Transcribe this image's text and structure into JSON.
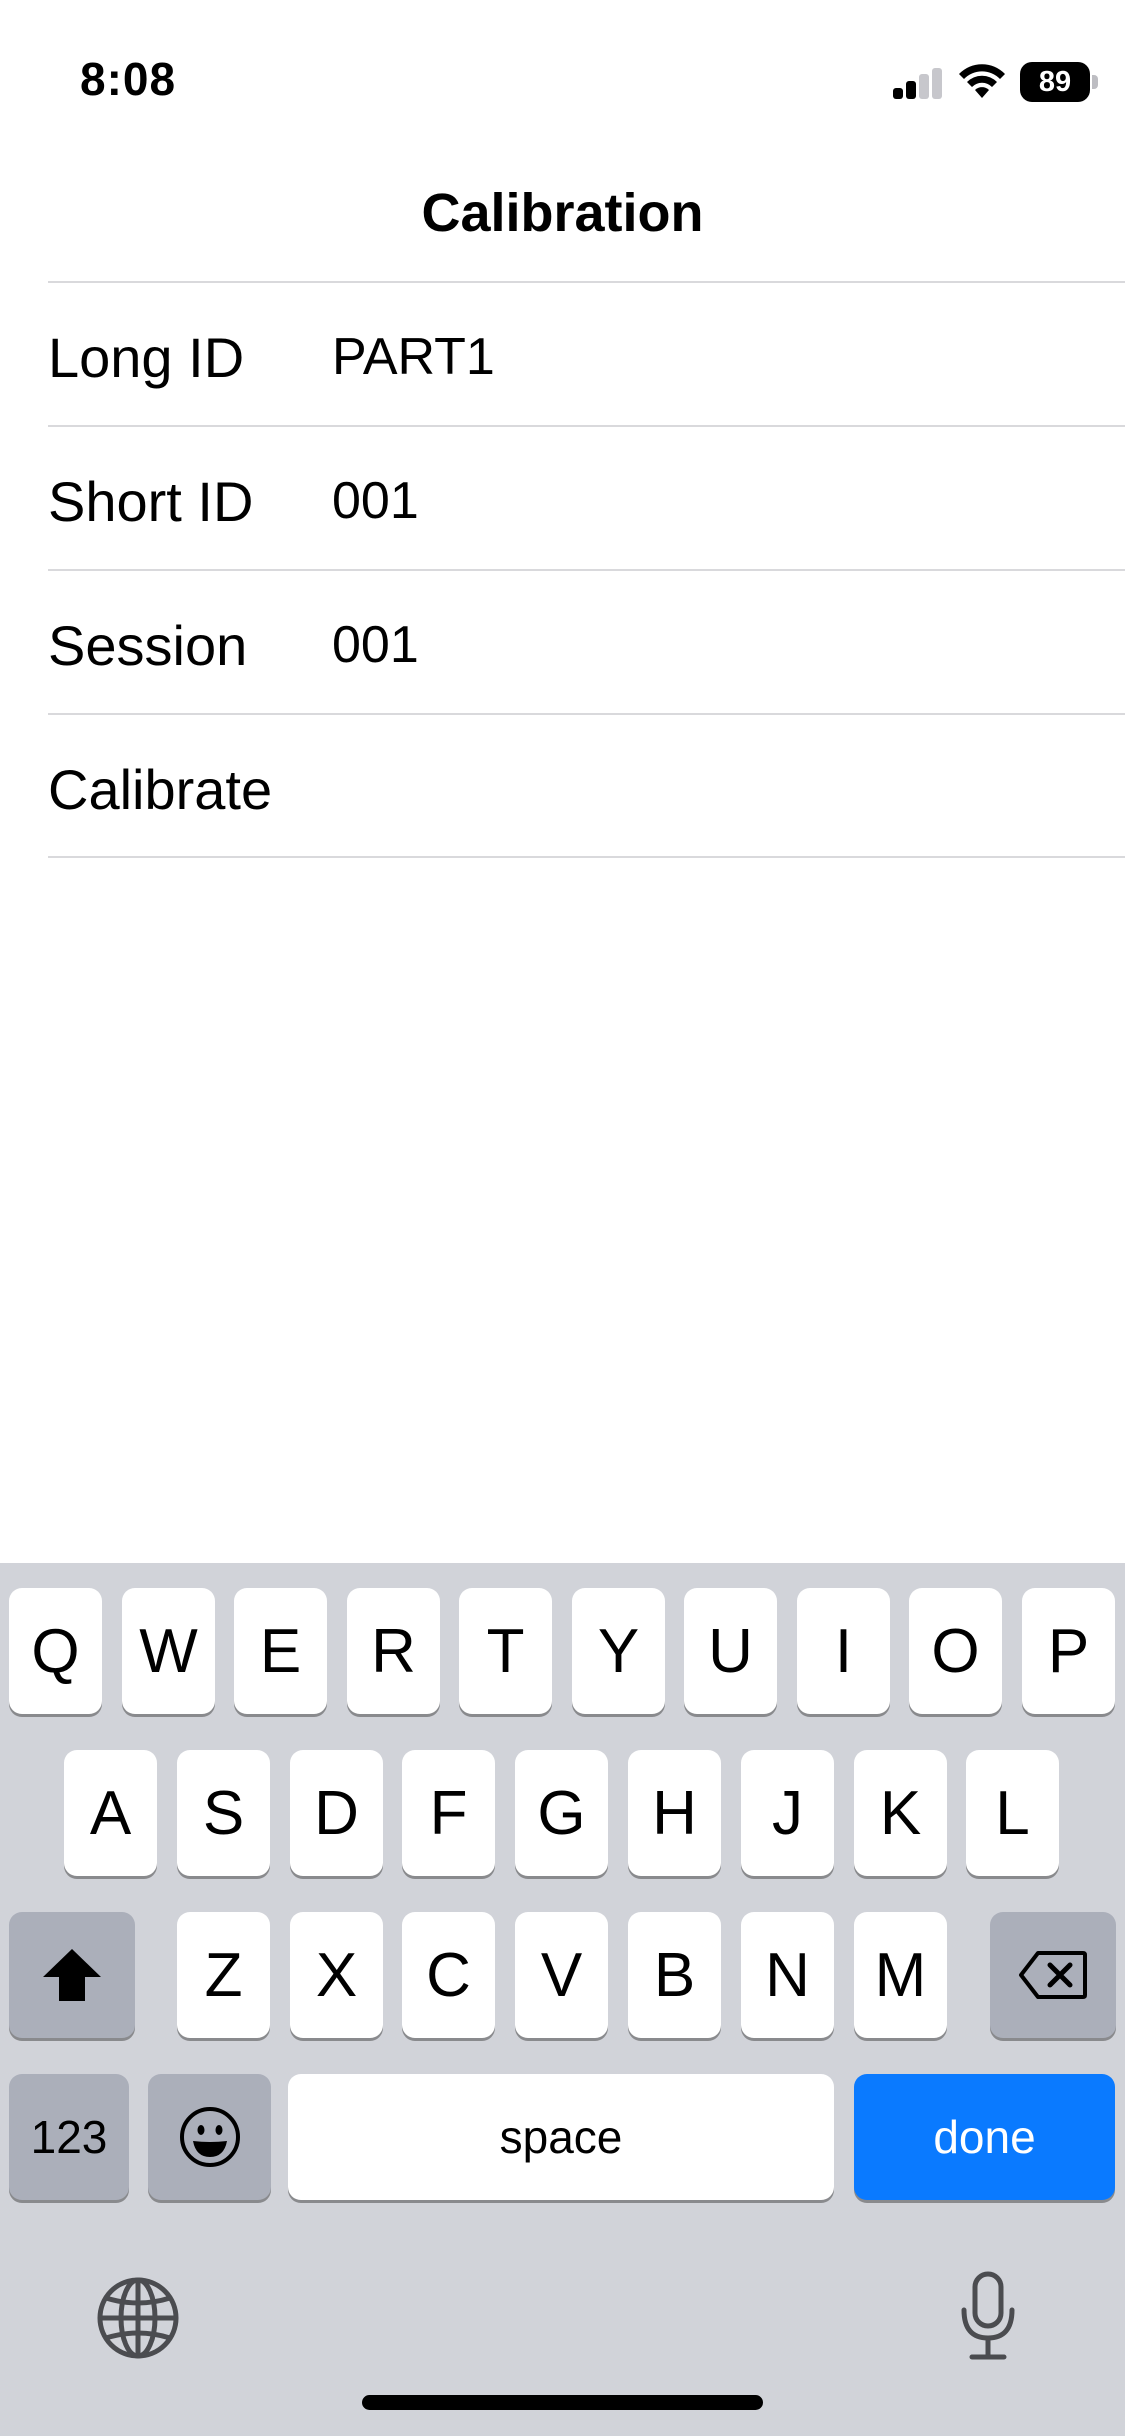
{
  "status_bar": {
    "time": "8:08",
    "battery": "89"
  },
  "nav": {
    "title": "Calibration"
  },
  "form": {
    "rows": [
      {
        "label": "Long ID",
        "value": "PART1"
      },
      {
        "label": "Short ID",
        "value": "001"
      },
      {
        "label": "Session",
        "value": "001"
      },
      {
        "label": "Calibrate",
        "value": ""
      }
    ]
  },
  "keyboard": {
    "row1": [
      "Q",
      "W",
      "E",
      "R",
      "T",
      "Y",
      "U",
      "I",
      "O",
      "P"
    ],
    "row2": [
      "A",
      "S",
      "D",
      "F",
      "G",
      "H",
      "J",
      "K",
      "L"
    ],
    "row3": [
      "Z",
      "X",
      "C",
      "V",
      "B",
      "N",
      "M"
    ],
    "numbers": "123",
    "space": "space",
    "done": "done",
    "icons": {
      "shift": "shift-icon",
      "delete": "backspace-icon",
      "emoji": "emoji-icon",
      "globe": "globe-icon",
      "mic": "microphone-icon"
    }
  },
  "colors": {
    "accent": "#0a7aff",
    "keyboard_bg": "#d1d3d9",
    "key_dark": "#abafba"
  }
}
